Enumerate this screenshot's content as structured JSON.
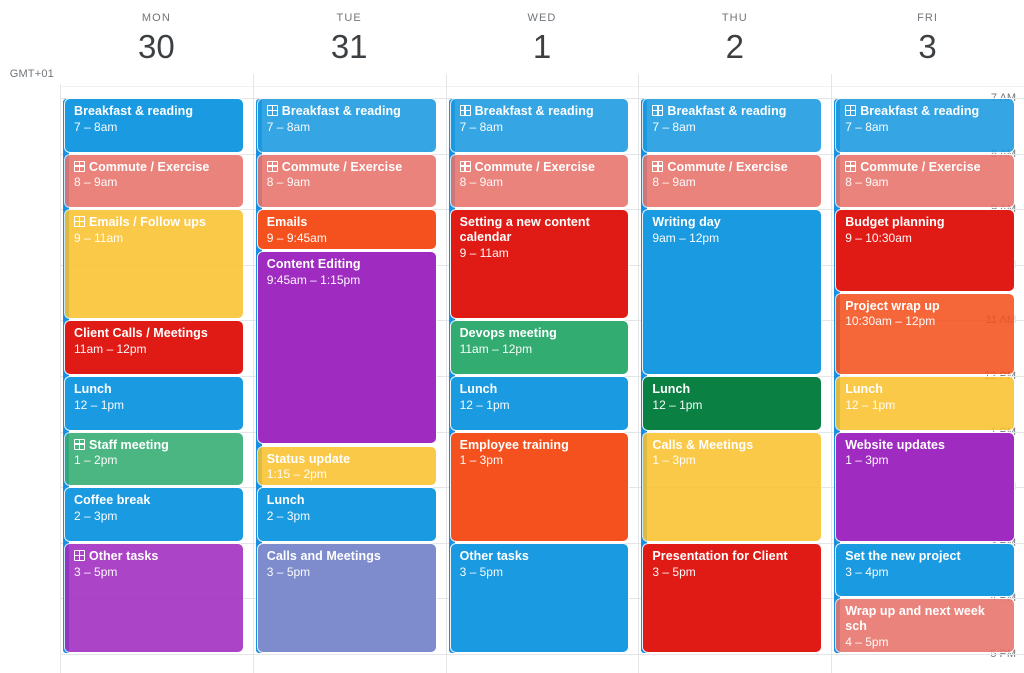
{
  "timezone_label": "GMT+01",
  "hours": [
    "7 AM",
    "8 AM",
    "9 AM",
    "10 AM",
    "11 AM",
    "12 PM",
    "1 PM",
    "2 PM",
    "3 PM",
    "4 PM",
    "5 PM"
  ],
  "days": [
    {
      "dow": "MON",
      "num": "30"
    },
    {
      "dow": "TUE",
      "num": "31"
    },
    {
      "dow": "WED",
      "num": "1"
    },
    {
      "dow": "THU",
      "num": "2"
    },
    {
      "dow": "FRI",
      "num": "3"
    }
  ],
  "events": [
    {
      "day": 0,
      "title": "Breakfast & reading",
      "time": "7 – 8am",
      "start": 7,
      "end": 8,
      "color": "#1a9ae0",
      "icon": false,
      "faded": false
    },
    {
      "day": 0,
      "title": "Commute / Exercise",
      "time": "8 – 9am",
      "start": 8,
      "end": 9,
      "color": "#e8736b",
      "icon": true,
      "faded": true
    },
    {
      "day": 0,
      "title": "Emails / Follow ups",
      "time": "9 – 11am",
      "start": 9,
      "end": 11,
      "color": "#f9c22e",
      "icon": true,
      "faded": true
    },
    {
      "day": 0,
      "title": "Client Calls / Meetings",
      "time": "11am – 12pm",
      "start": 11,
      "end": 12,
      "color": "#e01b16",
      "icon": false,
      "faded": false
    },
    {
      "day": 0,
      "title": "Lunch",
      "time": "12 – 1pm",
      "start": 12,
      "end": 13,
      "color": "#1a9ae0",
      "icon": false,
      "faded": false
    },
    {
      "day": 0,
      "title": "Staff meeting",
      "time": "1 – 2pm",
      "start": 13,
      "end": 14,
      "color": "#33ac71",
      "icon": true,
      "faded": true
    },
    {
      "day": 0,
      "title": "Coffee break",
      "time": "2 – 3pm",
      "start": 14,
      "end": 15,
      "color": "#1a9ae0",
      "icon": false,
      "faded": false
    },
    {
      "day": 0,
      "title": "Other tasks",
      "time": "3 – 5pm",
      "start": 15,
      "end": 17,
      "color": "#a02bc0",
      "icon": true,
      "faded": true
    },
    {
      "day": 1,
      "title": "Breakfast & reading",
      "time": "7 – 8am",
      "start": 7,
      "end": 8,
      "color": "#1a9ae0",
      "icon": true,
      "faded": true
    },
    {
      "day": 1,
      "title": "Commute / Exercise",
      "time": "8 – 9am",
      "start": 8,
      "end": 9,
      "color": "#e8736b",
      "icon": true,
      "faded": true
    },
    {
      "day": 1,
      "title": "Emails",
      "time": "9 – 9:45am",
      "start": 9,
      "end": 9.75,
      "color": "#f4511e",
      "icon": false,
      "faded": false
    },
    {
      "day": 1,
      "title": "Content Editing",
      "time": "9:45am – 1:15pm",
      "start": 9.75,
      "end": 13.25,
      "color": "#a02bc0",
      "icon": false,
      "faded": false
    },
    {
      "day": 1,
      "title": "Status update",
      "time": "1:15 – 2pm",
      "start": 13.25,
      "end": 14,
      "color": "#f9c22e",
      "icon": false,
      "faded": true
    },
    {
      "day": 1,
      "title": "Lunch",
      "time": "2 – 3pm",
      "start": 14,
      "end": 15,
      "color": "#1a9ae0",
      "icon": false,
      "faded": false
    },
    {
      "day": 1,
      "title": "Calls and Meetings",
      "time": "3 – 5pm",
      "start": 15,
      "end": 17,
      "color": "#7e8ccd",
      "icon": false,
      "faded": false
    },
    {
      "day": 2,
      "title": "Breakfast & reading",
      "time": "7 – 8am",
      "start": 7,
      "end": 8,
      "color": "#1a9ae0",
      "icon": true,
      "faded": true
    },
    {
      "day": 2,
      "title": "Commute / Exercise",
      "time": "8 – 9am",
      "start": 8,
      "end": 9,
      "color": "#e8736b",
      "icon": true,
      "faded": true
    },
    {
      "day": 2,
      "title": "Setting a new content calendar",
      "time": "9 – 11am",
      "start": 9,
      "end": 11,
      "color": "#e01b16",
      "icon": false,
      "faded": false
    },
    {
      "day": 2,
      "title": "Devops meeting",
      "time": "11am – 12pm",
      "start": 11,
      "end": 12,
      "color": "#33ac71",
      "icon": false,
      "faded": false
    },
    {
      "day": 2,
      "title": "Lunch",
      "time": "12 – 1pm",
      "start": 12,
      "end": 13,
      "color": "#1a9ae0",
      "icon": false,
      "faded": false
    },
    {
      "day": 2,
      "title": "Employee training",
      "time": "1 – 3pm",
      "start": 13,
      "end": 15,
      "color": "#f4511e",
      "icon": false,
      "faded": false
    },
    {
      "day": 2,
      "title": "Other tasks",
      "time": "3 – 5pm",
      "start": 15,
      "end": 17,
      "color": "#1a9ae0",
      "icon": false,
      "faded": false
    },
    {
      "day": 3,
      "title": "Breakfast & reading",
      "time": "7 – 8am",
      "start": 7,
      "end": 8,
      "color": "#1a9ae0",
      "icon": true,
      "faded": true
    },
    {
      "day": 3,
      "title": "Commute / Exercise",
      "time": "8 – 9am",
      "start": 8,
      "end": 9,
      "color": "#e8736b",
      "icon": true,
      "faded": true
    },
    {
      "day": 3,
      "title": "Writing day",
      "time": "9am – 12pm",
      "start": 9,
      "end": 12,
      "color": "#1a9ae0",
      "icon": false,
      "faded": false
    },
    {
      "day": 3,
      "title": "Lunch",
      "time": "12 – 1pm",
      "start": 12,
      "end": 13,
      "color": "#0b8043",
      "icon": false,
      "faded": false
    },
    {
      "day": 3,
      "title": "Calls & Meetings",
      "time": "1 – 3pm",
      "start": 13,
      "end": 15,
      "color": "#f9c22e",
      "icon": false,
      "faded": true
    },
    {
      "day": 3,
      "title": "Presentation for Client",
      "time": "3 – 5pm",
      "start": 15,
      "end": 17,
      "color": "#e01b16",
      "icon": false,
      "faded": false
    },
    {
      "day": 4,
      "title": "Breakfast & reading",
      "time": "7 – 8am",
      "start": 7,
      "end": 8,
      "color": "#1a9ae0",
      "icon": true,
      "faded": true
    },
    {
      "day": 4,
      "title": "Commute / Exercise",
      "time": "8 – 9am",
      "start": 8,
      "end": 9,
      "color": "#e8736b",
      "icon": true,
      "faded": true
    },
    {
      "day": 4,
      "title": "Budget planning",
      "time": "9 – 10:30am",
      "start": 9,
      "end": 10.5,
      "color": "#e01b16",
      "icon": false,
      "faded": false
    },
    {
      "day": 4,
      "title": "Project wrap up",
      "time": "10:30am – 12pm",
      "start": 10.5,
      "end": 12,
      "color": "#f4511e",
      "icon": false,
      "faded": true
    },
    {
      "day": 4,
      "title": "Lunch",
      "time": "12 – 1pm",
      "start": 12,
      "end": 13,
      "color": "#f9c22e",
      "icon": false,
      "faded": true
    },
    {
      "day": 4,
      "title": "Website updates",
      "time": "1 – 3pm",
      "start": 13,
      "end": 15,
      "color": "#a02bc0",
      "icon": false,
      "faded": false
    },
    {
      "day": 4,
      "title": "Set the new project",
      "time": "3 – 4pm",
      "start": 15,
      "end": 16,
      "color": "#1a9ae0",
      "icon": false,
      "faded": false
    },
    {
      "day": 4,
      "title": "Wrap up and next week sch",
      "time": "4 – 5pm",
      "start": 16,
      "end": 17,
      "color": "#e8736b",
      "icon": false,
      "faded": true
    }
  ]
}
